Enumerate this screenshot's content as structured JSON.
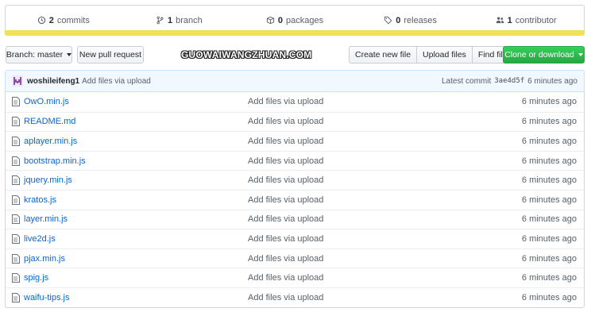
{
  "summary": {
    "commits_count": "2",
    "commits_label": "commits",
    "branch_count": "1",
    "branch_label": "branch",
    "packages_count": "0",
    "packages_label": "packages",
    "releases_count": "0",
    "releases_label": "releases",
    "contributor_count": "1",
    "contributor_label": "contributor"
  },
  "language_bar_color": "#f1e05a",
  "toolbar": {
    "branch_label": "Branch: master",
    "new_pull_request": "New pull request",
    "watermark": "GUOWAIWANGZHUAN.COM",
    "create_new_file": "Create new file",
    "upload_files": "Upload files",
    "find_file": "Find file",
    "clone_or_download": "Clone or download"
  },
  "latest_commit": {
    "author": "woshileifeng1",
    "message": "Add files via upload",
    "label": "Latest commit",
    "sha": "3ae4d5f",
    "age": "6 minutes ago"
  },
  "files": [
    {
      "name": "OwO.min.js",
      "message": "Add files via upload",
      "age": "6 minutes ago"
    },
    {
      "name": "README.md",
      "message": "Add files via upload",
      "age": "6 minutes ago"
    },
    {
      "name": "aplayer.min.js",
      "message": "Add files via upload",
      "age": "6 minutes ago"
    },
    {
      "name": "bootstrap.min.js",
      "message": "Add files via upload",
      "age": "6 minutes ago"
    },
    {
      "name": "jquery.min.js",
      "message": "Add files via upload",
      "age": "6 minutes ago"
    },
    {
      "name": "kratos.js",
      "message": "Add files via upload",
      "age": "6 minutes ago"
    },
    {
      "name": "layer.min.js",
      "message": "Add files via upload",
      "age": "6 minutes ago"
    },
    {
      "name": "live2d.js",
      "message": "Add files via upload",
      "age": "6 minutes ago"
    },
    {
      "name": "pjax.min.js",
      "message": "Add files via upload",
      "age": "6 minutes ago"
    },
    {
      "name": "spig.js",
      "message": "Add files via upload",
      "age": "6 minutes ago"
    },
    {
      "name": "waifu-tips.js",
      "message": "Add files via upload",
      "age": "6 minutes ago"
    }
  ]
}
